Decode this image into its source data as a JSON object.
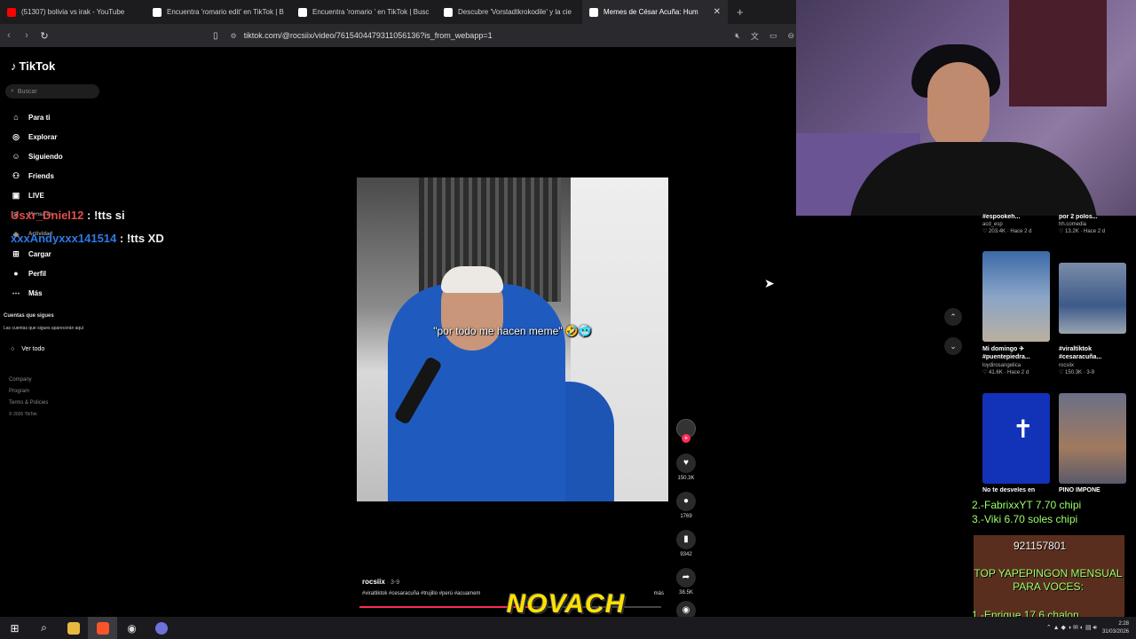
{
  "browser": {
    "tabs": [
      {
        "label": "(51307) bolivia vs irak - YouTube",
        "icon": "youtube-icon",
        "color": "#ff0000"
      },
      {
        "label": "Encuentra 'romario edit' en TikTok | B",
        "icon": "tiktok-icon",
        "color": "#ffffff"
      },
      {
        "label": "Encuentra 'romario ' en TikTok | Busc",
        "icon": "tiktok-icon",
        "color": "#ffffff"
      },
      {
        "label": "Descubre 'Vorstadtkrokodile' y la cie",
        "icon": "tiktok-icon",
        "color": "#ffffff"
      },
      {
        "label": "Memes de César Acuña: Hum",
        "icon": "tiktok-icon",
        "color": "#ffffff",
        "active": true
      }
    ],
    "url": "tiktok.com/@rocsiix/video/7615404479311056136?is_from_webapp=1"
  },
  "sidebar": {
    "logo": "TikTok",
    "search_placeholder": "Buscar",
    "items": [
      {
        "label": "Para ti",
        "icon": "home-icon",
        "glyph": "⌂"
      },
      {
        "label": "Explorar",
        "icon": "compass-icon",
        "glyph": "◎"
      },
      {
        "label": "Siguiendo",
        "icon": "following-icon",
        "glyph": "☺"
      },
      {
        "label": "Friends",
        "icon": "friends-icon",
        "glyph": "⚇"
      },
      {
        "label": "LIVE",
        "icon": "live-icon",
        "glyph": "▣"
      },
      {
        "label": "Mensajes",
        "icon": "messages-icon",
        "glyph": "✉"
      },
      {
        "label": "Actividad",
        "icon": "activity-icon",
        "glyph": "◈"
      },
      {
        "label": "Cargar",
        "icon": "upload-icon",
        "glyph": "⊞"
      },
      {
        "label": "Perfil",
        "icon": "profile-icon",
        "glyph": "●"
      },
      {
        "label": "Más",
        "icon": "more-icon",
        "glyph": "⋯"
      }
    ],
    "following_title": "Cuentas que sigues",
    "following_sub": "Las cuentas que sigues aparecerán aquí",
    "see_all": "Ver todo",
    "footer": [
      "Company",
      "Program",
      "Terms & Policies"
    ],
    "copyright": "© 2026 TikTok"
  },
  "chat": [
    {
      "user": "Usxr_Dniel12",
      "msg": ": !tts si"
    },
    {
      "user": "xxxAndyxxx141514",
      "msg": ": !tts XD"
    }
  ],
  "video": {
    "caption": "\"por todo me hacen meme\" 🤣🥶",
    "author": "rocsiix",
    "date": "· 3-9",
    "tags": "#viraltiktok #cesaracuña #trujillo #perú #acuamem",
    "more": "más",
    "progress": 0.58,
    "watermark": "NOVACH"
  },
  "actions": {
    "likes": "150.3K",
    "comments": "1769",
    "saves": "9342",
    "shares": "38.5K"
  },
  "feed": [
    {
      "title": "#espookeh...",
      "account": "acd_esp",
      "meta": "♡ 203.4K · Hace 2 d"
    },
    {
      "title": "por 2 polos...",
      "account": "hh.comedia",
      "meta": "♡ 13.2K · Hace 2 d"
    },
    {
      "title": "Mi domingo ✈ #puentepiedra...",
      "account": "loydirosangelica",
      "meta": "♡ 41.6K · Hace 2 d"
    },
    {
      "title": "#viraltiktok #cesaracuña...",
      "account": "rocsiix",
      "meta": "♡ 150.3K · 3-9"
    },
    {
      "title": "No te desveles en",
      "account": "",
      "meta": ""
    },
    {
      "title": "PINO IMPONE",
      "account": "",
      "meta": ""
    }
  ],
  "ranking": [
    "2.-FabrixxYT 7.70 chipi",
    "3.-Viki 6.70 soles chipi"
  ],
  "donation": {
    "number": "921157801",
    "title": "TOP YAPEPINGON MENSUAL PARA VOCES:",
    "first": "1.-Enrique 17.6 chalon"
  },
  "taskbar": {
    "time": "2:28",
    "date": "31/03/2026"
  }
}
